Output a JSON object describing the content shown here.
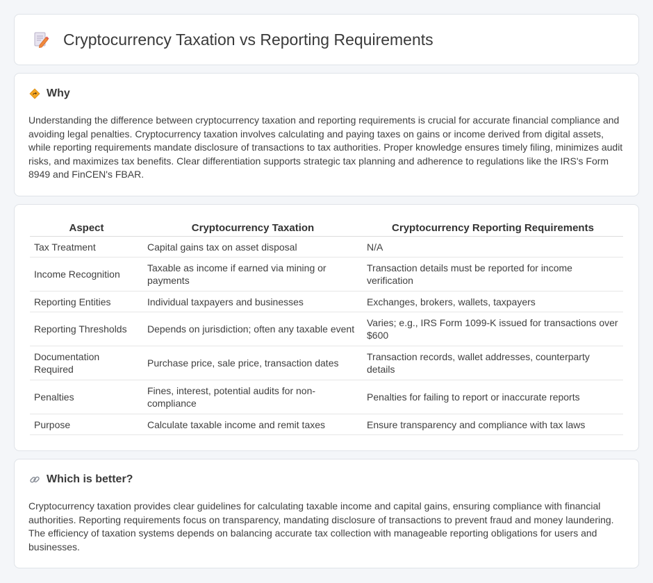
{
  "header": {
    "title": "Cryptocurrency Taxation vs Reporting Requirements",
    "icon": "document-pencil-icon"
  },
  "why": {
    "heading": "Why",
    "icon": "diamond-sign-icon",
    "text": "Understanding the difference between cryptocurrency taxation and reporting requirements is crucial for accurate financial compliance and avoiding legal penalties. Cryptocurrency taxation involves calculating and paying taxes on gains or income derived from digital assets, while reporting requirements mandate disclosure of transactions to tax authorities. Proper knowledge ensures timely filing, minimizes audit risks, and maximizes tax benefits. Clear differentiation supports strategic tax planning and adherence to regulations like the IRS's Form 8949 and FinCEN's FBAR."
  },
  "table": {
    "headers": [
      "Aspect",
      "Cryptocurrency Taxation",
      "Cryptocurrency Reporting Requirements"
    ],
    "rows": [
      [
        "Tax Treatment",
        "Capital gains tax on asset disposal",
        "N/A"
      ],
      [
        "Income Recognition",
        "Taxable as income if earned via mining or payments",
        "Transaction details must be reported for income verification"
      ],
      [
        "Reporting Entities",
        "Individual taxpayers and businesses",
        "Exchanges, brokers, wallets, taxpayers"
      ],
      [
        "Reporting Thresholds",
        "Depends on jurisdiction; often any taxable event",
        "Varies; e.g., IRS Form 1099-K issued for transactions over $600"
      ],
      [
        "Documentation Required",
        "Purchase price, sale price, transaction dates",
        "Transaction records, wallet addresses, counterparty details"
      ],
      [
        "Penalties",
        "Fines, interest, potential audits for non-compliance",
        "Penalties for failing to report or inaccurate reports"
      ],
      [
        "Purpose",
        "Calculate taxable income and remit taxes",
        "Ensure transparency and compliance with tax laws"
      ]
    ]
  },
  "better": {
    "heading": "Which is better?",
    "icon": "link-icon",
    "text": "Cryptocurrency taxation provides clear guidelines for calculating taxable income and capital gains, ensuring compliance with financial authorities. Reporting requirements focus on transparency, mandating disclosure of transactions to prevent fraud and money laundering. The efficiency of taxation systems depends on balancing accurate tax collection with manageable reporting obligations for users and businesses."
  },
  "colors": {
    "background": "#f4f6f9",
    "card": "#ffffff",
    "border": "#dfe3e8",
    "accent_orange": "#f0a030"
  }
}
